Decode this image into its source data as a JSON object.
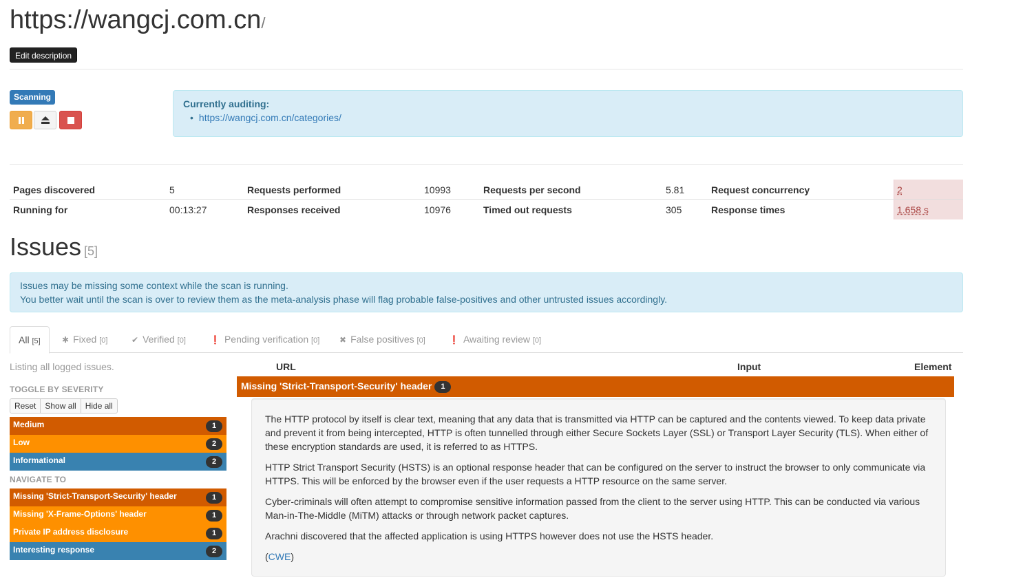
{
  "header": {
    "site_url": "https://wangcj.com.cn",
    "site_url_suffix": "/",
    "edit_description_label": "Edit description"
  },
  "scan": {
    "status_badge": "Scanning",
    "controls": {
      "pause_icon": "pause-icon",
      "suspend_icon": "eject-icon",
      "abort_icon": "stop-icon"
    },
    "auditing_title": "Currently auditing:",
    "auditing_url": "https://wangcj.com.cn/categories/"
  },
  "stats": {
    "pages_discovered_label": "Pages discovered",
    "pages_discovered_value": "5",
    "requests_performed_label": "Requests performed",
    "requests_performed_value": "10993",
    "requests_per_second_label": "Requests per second",
    "requests_per_second_value": "5.81",
    "request_concurrency_label": "Request concurrency",
    "request_concurrency_value": "2",
    "running_for_label": "Running for",
    "running_for_value": "00:13:27",
    "responses_received_label": "Responses received",
    "responses_received_value": "10976",
    "timed_out_label": "Timed out requests",
    "timed_out_value": "305",
    "response_times_label": "Response times",
    "response_times_value": "1.658 s"
  },
  "issues": {
    "title": "Issues",
    "count": "[5]",
    "notice_line1": "Issues may be missing some context while the scan is running.",
    "notice_line2": "You better wait until the scan is over to review them as the meta-analysis phase will flag probable false-positives and other untrusted issues accordingly."
  },
  "tabs": [
    {
      "label": "All",
      "count": "[5]",
      "active": true
    },
    {
      "label": "Fixed",
      "count": "[0]",
      "icon": "asterisk-icon"
    },
    {
      "label": "Verified",
      "count": "[0]",
      "icon": "check-icon"
    },
    {
      "label": "Pending verification",
      "count": "[0]",
      "icon": "exclamation-circle-icon"
    },
    {
      "label": "False positives",
      "count": "[0]",
      "icon": "times-icon"
    },
    {
      "label": "Awaiting review",
      "count": "[0]",
      "icon": "exclamation-circle-icon"
    }
  ],
  "sidebar": {
    "listing_text": "Listing all logged issues.",
    "toggle_heading": "TOGGLE BY SEVERITY",
    "toggle_buttons": [
      "Reset",
      "Show all",
      "Hide all"
    ],
    "severities": [
      {
        "label": "Medium",
        "count": "1"
      },
      {
        "label": "Low",
        "count": "2"
      },
      {
        "label": "Informational",
        "count": "2"
      }
    ],
    "navigate_heading": "NAVIGATE TO",
    "navigate": [
      {
        "label": "Missing 'Strict-Transport-Security' header",
        "count": "1"
      },
      {
        "label": "Missing 'X-Frame-Options' header",
        "count": "1"
      },
      {
        "label": "Private IP address disclosure",
        "count": "1"
      },
      {
        "label": "Interesting response",
        "count": "2"
      }
    ]
  },
  "table": {
    "col_url": "URL",
    "col_input": "Input",
    "col_element": "Element",
    "issue_name": "Missing 'Strict-Transport-Security' header",
    "issue_count": "1",
    "description": {
      "p1": "The HTTP protocol by itself is clear text, meaning that any data that is transmitted via HTTP can be captured and the contents viewed. To keep data private and prevent it from being intercepted, HTTP is often tunnelled through either Secure Sockets Layer (SSL) or Transport Layer Security (TLS). When either of these encryption standards are used, it is referred to as HTTPS.",
      "p2": "HTTP Strict Transport Security (HSTS) is an optional response header that can be configured on the server to instruct the browser to only communicate via HTTPS. This will be enforced by the browser even if the user requests a HTTP resource on the same server.",
      "p3": "Cyber-criminals will often attempt to compromise sensitive information passed from the client to the server using HTTP. This can be conducted via various Man-in-The-Middle (MiTM) attacks or through network packet captures.",
      "p4": "Arachni discovered that the affected application is using HTTPS however does not use the HSTS header.",
      "ref_open": "(",
      "ref_link": "CWE",
      "ref_close": ")"
    }
  },
  "colors": {
    "medium": "#d15b00",
    "low": "#fe9000",
    "informational": "#3982b0",
    "primary": "#337ab7"
  }
}
